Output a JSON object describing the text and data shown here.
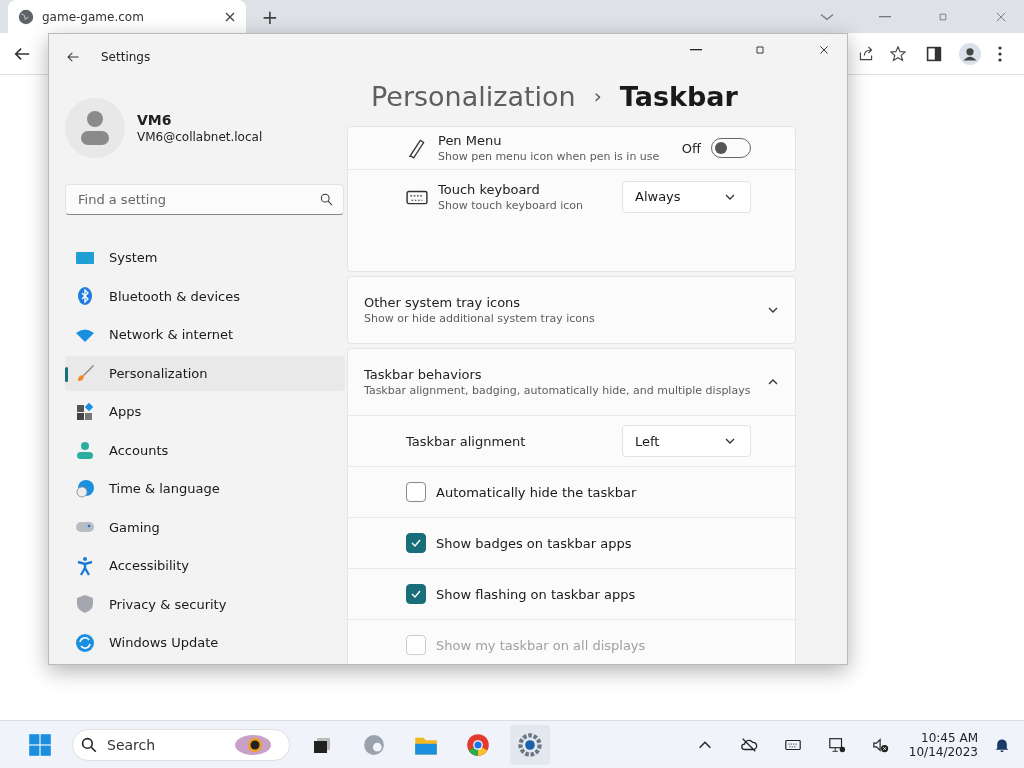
{
  "browser": {
    "tab_title": "game-game.com",
    "new_tab": "+"
  },
  "settings": {
    "title": "Settings",
    "user": {
      "name": "VM6",
      "email": "VM6@collabnet.local"
    },
    "search": {
      "placeholder": "Find a setting"
    },
    "nav": [
      {
        "label": "System",
        "selected": false
      },
      {
        "label": "Bluetooth & devices",
        "selected": false
      },
      {
        "label": "Network & internet",
        "selected": false
      },
      {
        "label": "Personalization",
        "selected": true
      },
      {
        "label": "Apps",
        "selected": false
      },
      {
        "label": "Accounts",
        "selected": false
      },
      {
        "label": "Time & language",
        "selected": false
      },
      {
        "label": "Gaming",
        "selected": false
      },
      {
        "label": "Accessibility",
        "selected": false
      },
      {
        "label": "Privacy & security",
        "selected": false
      },
      {
        "label": "Windows Update",
        "selected": false
      }
    ],
    "breadcrumb": {
      "parent": "Personalization",
      "separator": "›",
      "current": "Taskbar"
    },
    "pen_rows": [
      {
        "kind": "toggle",
        "title": "Pen Menu",
        "description": "Show pen menu icon when pen is in use",
        "value_label": "Off",
        "on": false
      },
      {
        "kind": "dropdown",
        "title": "Touch keyboard",
        "description": "Show touch keyboard icon",
        "value": "Always"
      }
    ],
    "sections": [
      {
        "title": "Other system tray icons",
        "description": "Show or hide additional system tray icons",
        "expanded": false
      },
      {
        "title": "Taskbar behaviors",
        "description": "Taskbar alignment, badging, automatically hide, and multiple displays",
        "expanded": true,
        "settings": [
          {
            "kind": "dropdown",
            "label": "Taskbar alignment",
            "value": "Left"
          },
          {
            "kind": "checkbox",
            "label": "Automatically hide the taskbar",
            "checked": false,
            "disabled": false
          },
          {
            "kind": "checkbox",
            "label": "Show badges on taskbar apps",
            "checked": true,
            "disabled": false
          },
          {
            "kind": "checkbox",
            "label": "Show flashing on taskbar apps",
            "checked": true,
            "disabled": false
          },
          {
            "kind": "checkbox",
            "label": "Show my taskbar on all displays",
            "checked": false,
            "disabled": true
          }
        ]
      }
    ]
  },
  "taskbar": {
    "search_placeholder": "Search",
    "time": "10:45 AM",
    "date": "10/14/2023"
  }
}
